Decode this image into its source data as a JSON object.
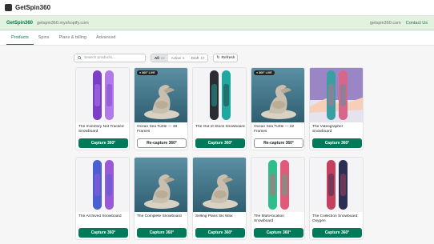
{
  "app": {
    "name": "GetSpin360"
  },
  "shop": {
    "title": "GetSpin360",
    "domain": "getspin360.myshopify.com",
    "email": "getspin360.com",
    "contact_label": "Contact Us"
  },
  "tabs": [
    {
      "label": "Products",
      "active": true
    },
    {
      "label": "Spins",
      "active": false
    },
    {
      "label": "Plans & billing",
      "active": false
    },
    {
      "label": "Advanced",
      "active": false
    }
  ],
  "toolbar": {
    "search_placeholder": "Search products...",
    "filters": [
      {
        "label": "All",
        "count": "12",
        "active": true
      },
      {
        "label": "Active",
        "count": "5",
        "active": false
      },
      {
        "label": "Draft",
        "count": "10",
        "active": false
      }
    ],
    "refresh_label": "Refresh"
  },
  "products": [
    {
      "title": "The Inventory Not Tracked Snowboard",
      "action": "Capture 360°",
      "live": false,
      "art": "board-purple"
    },
    {
      "title": "Ocean Sea Turtle — 48 Frames",
      "action": "Re-capture 360°",
      "live": true,
      "badge": "● 360° LIVE",
      "art": "turtle"
    },
    {
      "title": "The Out of Stock Snowboard",
      "action": "Capture 360°",
      "live": false,
      "art": "board-dark"
    },
    {
      "title": "Ocean Sea Turtle — 32 Frames",
      "action": "Re-capture 360°",
      "live": true,
      "badge": "● 360° LIVE",
      "art": "turtle"
    },
    {
      "title": "The Videographer Snowboard",
      "action": "Capture 360°",
      "live": false,
      "art": "board-sunset"
    },
    {
      "title": "The Archived Snowboard",
      "action": "Capture 360°",
      "live": false,
      "art": "board-blue"
    },
    {
      "title": "The Complete Snowboard",
      "action": "Capture 360°",
      "live": false,
      "art": "turtle"
    },
    {
      "title": "Selling Plans Ski Wax",
      "action": "Capture 360°",
      "live": false,
      "art": "turtle"
    },
    {
      "title": "The Multi-location Snowboard",
      "action": "Capture 360°",
      "live": false,
      "art": "board-green"
    },
    {
      "title": "The Collection Snowboard: Oxygen",
      "action": "Capture 360°",
      "live": false,
      "art": "board-oxygen"
    }
  ],
  "colors": {
    "accent": "#007a5a",
    "shopbar": "#e3f1df",
    "badge": "#202223"
  }
}
